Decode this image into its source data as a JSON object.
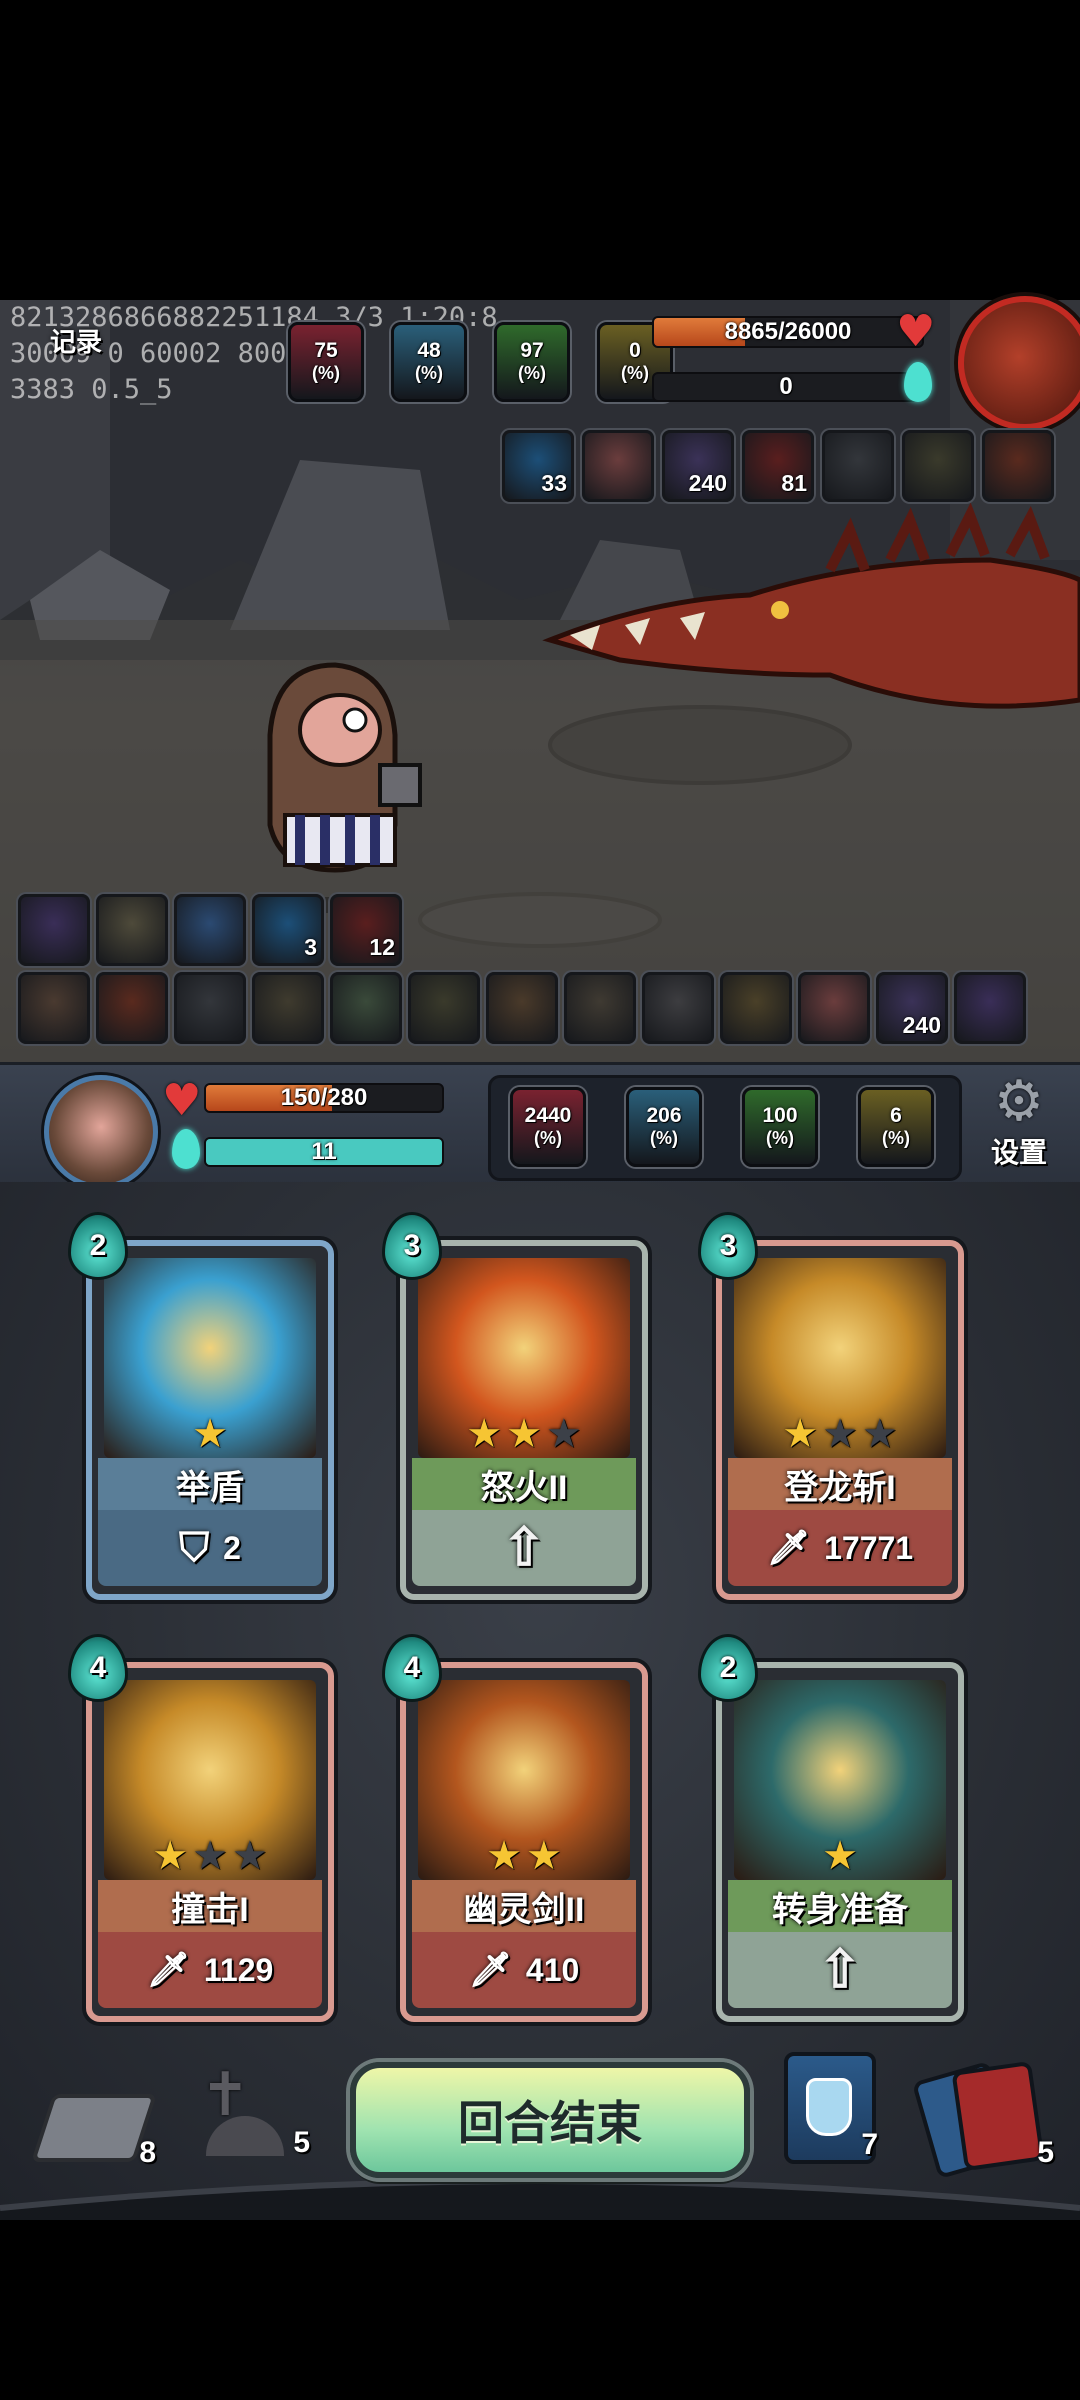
{
  "debug": {
    "line1": "8213286866882251184 3/3 1:20:8",
    "line2": "30009 0 60002 80056",
    "line3": "3383 0.5_5"
  },
  "record_label": "记录",
  "enemy": {
    "stats": [
      {
        "value": "75",
        "unit": "(%)",
        "color": "#7a2230",
        "icon": "attack-icon"
      },
      {
        "value": "48",
        "unit": "(%)",
        "color": "#2a5f7a",
        "icon": "crit-icon"
      },
      {
        "value": "97",
        "unit": "(%)",
        "color": "#2f6a2b",
        "icon": "defense-icon"
      },
      {
        "value": "0",
        "unit": "(%)",
        "color": "#6a5f22",
        "icon": "dodge-icon"
      }
    ],
    "hp_text": "8865/26000",
    "hp_fraction": 0.34,
    "energy_text": "0",
    "energy_fraction": 0,
    "buffs": [
      {
        "icon": "shield-icon",
        "count": "33",
        "bg": "#1c4f78"
      },
      {
        "icon": "crystal-flesh-icon",
        "count": "",
        "bg": "#6b3d3d"
      },
      {
        "icon": "dice-sword-icon",
        "count": "240",
        "bg": "#3b3258"
      },
      {
        "icon": "claw-slash-icon",
        "count": "81",
        "bg": "#5a1e1e"
      },
      {
        "icon": "spiked-collar-icon",
        "count": "",
        "bg": "#33363b"
      },
      {
        "icon": "hourglass-icon",
        "count": "",
        "bg": "#3a3a2b"
      },
      {
        "icon": "fire-apple-icon",
        "count": "",
        "bg": "#5a2a1e"
      }
    ]
  },
  "player_buffs": {
    "row1": [
      {
        "icon": "purple-gem-icon",
        "count": "",
        "bg": "#3a2e58"
      },
      {
        "icon": "sun-gear-icon",
        "count": "",
        "bg": "#4e4a3a"
      },
      {
        "icon": "shield-badge-icon",
        "count": "",
        "bg": "#2b4a72"
      },
      {
        "icon": "shield-icon",
        "count": "3",
        "bg": "#1c4f78"
      },
      {
        "icon": "flame-icon",
        "count": "12",
        "bg": "#5a1e1e"
      }
    ],
    "row2": [
      {
        "icon": "helmet-icon",
        "count": "",
        "bg": "#4a3a30"
      },
      {
        "icon": "fire-apple-icon",
        "count": "",
        "bg": "#5a2a1e"
      },
      {
        "icon": "spiked-collar-icon",
        "count": "",
        "bg": "#33363b"
      },
      {
        "icon": "cannon-icon",
        "count": "",
        "bg": "#3f3b2e"
      },
      {
        "icon": "goblin-helm-icon",
        "count": "",
        "bg": "#3a4a3a"
      },
      {
        "icon": "hourglass-icon",
        "count": "",
        "bg": "#3a3a2b"
      },
      {
        "icon": "pouch-icon",
        "count": "",
        "bg": "#4a3a2a"
      },
      {
        "icon": "owl-icon",
        "count": "",
        "bg": "#3f3a32"
      },
      {
        "icon": "teacup-icon",
        "count": "",
        "bg": "#3d3d40"
      },
      {
        "icon": "golden-flute-icon",
        "count": "",
        "bg": "#4a4028"
      },
      {
        "icon": "crystal-flesh-icon",
        "count": "",
        "bg": "#6b3d3d"
      },
      {
        "icon": "dice-sword-icon",
        "count": "240",
        "bg": "#3b3258"
      },
      {
        "icon": "dark-crystal-icon",
        "count": "",
        "bg": "#3a2e58"
      }
    ]
  },
  "player": {
    "hp_text": "150/280",
    "hp_fraction": 0.536,
    "energy_text": "11",
    "energy_fraction": 1.0,
    "stats": [
      {
        "value": "2440",
        "unit": "(%)",
        "color": "#7a2230",
        "icon": "attack-icon"
      },
      {
        "value": "206",
        "unit": "(%)",
        "color": "#2a5f7a",
        "icon": "crit-icon"
      },
      {
        "value": "100",
        "unit": "(%)",
        "color": "#2f6a2b",
        "icon": "defense-icon"
      },
      {
        "value": "6",
        "unit": "(%)",
        "color": "#6a5f22",
        "icon": "dodge-icon"
      }
    ],
    "settings_label": "设置"
  },
  "cards": [
    {
      "cost": "2",
      "name": "举盾",
      "foot_icon": "shield-outline-icon",
      "foot_value": "2",
      "stars": 1,
      "max_stars": 1,
      "frame": "#7fa6c9",
      "band": "#5a7e98",
      "foot_bg": "#4a6a84",
      "art_bg": "#3aa0d0",
      "upgrade": false
    },
    {
      "cost": "3",
      "name": "怒火II",
      "foot_icon": "upgrade-arrow-icon",
      "foot_value": "",
      "stars": 2,
      "max_stars": 3,
      "frame": "#a8b4ad",
      "band": "#6e9a5a",
      "foot_bg": "#8fa396",
      "art_bg": "#d2561e",
      "upgrade": true
    },
    {
      "cost": "3",
      "name": "登龙斩I",
      "foot_icon": "sword-damage-icon",
      "foot_value": "17771",
      "stars": 1,
      "max_stars": 3,
      "frame": "#d99a90",
      "band": "#b06d4e",
      "foot_bg": "#9e4a42",
      "art_bg": "#c68a28",
      "upgrade": false
    },
    {
      "cost": "4",
      "name": "撞击I",
      "foot_icon": "sword-damage-icon",
      "foot_value": "1129",
      "stars": 1,
      "max_stars": 3,
      "frame": "#d99a90",
      "band": "#b06d4e",
      "foot_bg": "#9e4a42",
      "art_bg": "#c68a28",
      "upgrade": false
    },
    {
      "cost": "4",
      "name": "幽灵剑II",
      "foot_icon": "sword-damage-icon",
      "foot_value": "410",
      "stars": 2,
      "max_stars": 2,
      "frame": "#d99a90",
      "band": "#b06d4e",
      "foot_bg": "#9e4a42",
      "art_bg": "#b3561e",
      "upgrade": false
    },
    {
      "cost": "2",
      "name": "转身准备",
      "foot_icon": "upgrade-arrow-icon",
      "foot_value": "",
      "stars": 1,
      "max_stars": 1,
      "frame": "#a8b4ad",
      "band": "#6e9a5a",
      "foot_bg": "#8fa396",
      "art_bg": "#2d6a6a",
      "upgrade": true
    }
  ],
  "end_turn_label": "回合结束",
  "piles": {
    "draw_count": "8",
    "grave_count": "5",
    "potion_count": "7",
    "discard_count": "5"
  }
}
